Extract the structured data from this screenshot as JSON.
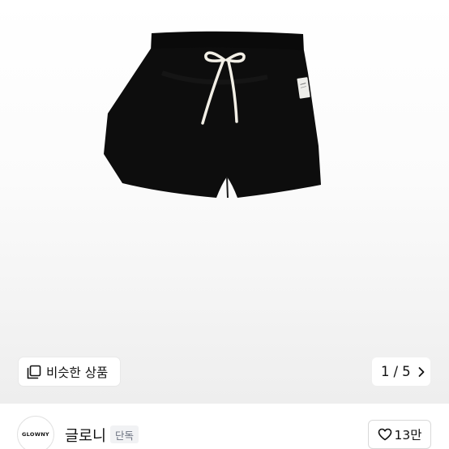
{
  "similar": {
    "label": "비슷한 상품",
    "icon": "similar-items-icon"
  },
  "pager": {
    "current": "1",
    "separator": "/",
    "total": "5",
    "icon": "chevron-right-icon"
  },
  "brand": {
    "logo_text": "GLOWNY",
    "name": "글로니",
    "badge": "단독"
  },
  "like": {
    "count": "13만",
    "icon": "heart-outline-icon"
  },
  "colors": {
    "product": "#0d0d0d",
    "drawstring": "#f2efe6",
    "badge_bg": "#f1f2f4",
    "badge_text": "#6b7280"
  }
}
